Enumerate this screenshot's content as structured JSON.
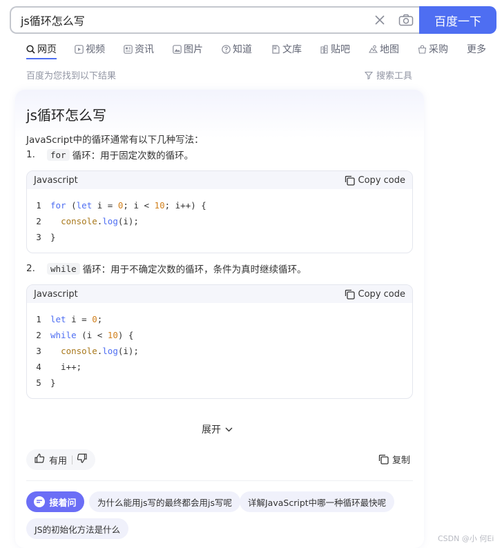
{
  "search": {
    "query": "js循环怎么写",
    "button_label": "百度一下"
  },
  "tabs": [
    {
      "label": "网页",
      "icon": "search-icon"
    },
    {
      "label": "视频",
      "icon": "video-icon"
    },
    {
      "label": "资讯",
      "icon": "news-icon"
    },
    {
      "label": "图片",
      "icon": "image-icon"
    },
    {
      "label": "知道",
      "icon": "question-icon"
    },
    {
      "label": "文库",
      "icon": "doc-icon"
    },
    {
      "label": "贴吧",
      "icon": "tieba-icon"
    },
    {
      "label": "地图",
      "icon": "map-icon"
    },
    {
      "label": "采购",
      "icon": "shop-icon"
    },
    {
      "label": "更多",
      "icon": ""
    }
  ],
  "result_count": "百度为您找到以下结果",
  "search_tools": "搜索工具",
  "answer": {
    "title": "js循环怎么写",
    "intro": "JavaScript中的循环通常有以下几种写法：",
    "items": [
      {
        "num": "1.",
        "keyword": "for",
        "text": "循环：用于固定次数的循环。"
      },
      {
        "num": "2.",
        "keyword": "while",
        "text": "循环：用于不确定次数的循环，条件为真时继续循环。"
      }
    ],
    "code_blocks": [
      {
        "language": "Javascript",
        "copy_label": "Copy code",
        "lines": [
          {
            "n": "1",
            "code": "for (let i = 0; i < 10; i++) {"
          },
          {
            "n": "2",
            "code": "  console.log(i);"
          },
          {
            "n": "3",
            "code": "}"
          }
        ]
      },
      {
        "language": "Javascript",
        "copy_label": "Copy code",
        "lines": [
          {
            "n": "1",
            "code": "let i = 0;"
          },
          {
            "n": "2",
            "code": "while (i < 10) {"
          },
          {
            "n": "3",
            "code": "  console.log(i);"
          },
          {
            "n": "4",
            "code": "  i++;"
          },
          {
            "n": "5",
            "code": "}"
          }
        ]
      }
    ],
    "expand_label": "展开",
    "useful_label": "有用",
    "copy_label": "复制"
  },
  "ask": {
    "button_label": "接着问",
    "chips": [
      "为什么能用js写的最终都会用js写呢",
      "详解JavaScript中哪一种循环最快呢",
      "JS的初始化方法是什么"
    ]
  },
  "watermark": "CSDN @小 何Ei",
  "colors": {
    "accent": "#4e6ef2",
    "ask": "#6b6ef6"
  }
}
